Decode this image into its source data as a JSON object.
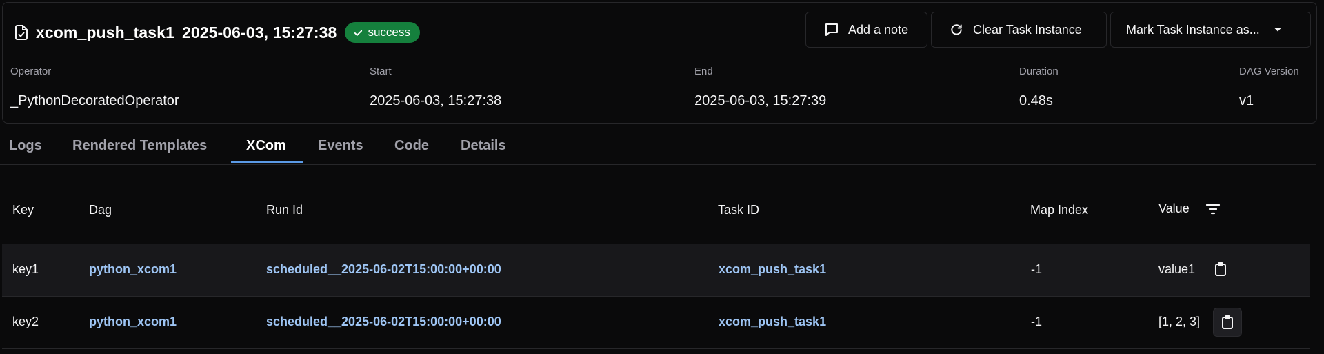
{
  "task": {
    "name": "xcom_push_task1",
    "datetime": "2025-06-03, 15:27:38",
    "status": "success"
  },
  "buttons": {
    "add_note": "Add a note",
    "clear": "Clear Task Instance",
    "mark": "Mark Task Instance as..."
  },
  "meta": {
    "operator": {
      "label": "Operator",
      "value": "_PythonDecoratedOperator"
    },
    "start": {
      "label": "Start",
      "value": "2025-06-03, 15:27:38"
    },
    "end": {
      "label": "End",
      "value": "2025-06-03, 15:27:39"
    },
    "duration": {
      "label": "Duration",
      "value": "0.48s"
    },
    "dag_version": {
      "label": "DAG Version",
      "value": "v1"
    }
  },
  "tabs": [
    "Logs",
    "Rendered Templates",
    "XCom",
    "Events",
    "Code",
    "Details"
  ],
  "active_tab": "XCom",
  "table": {
    "headers": {
      "key": "Key",
      "dag": "Dag",
      "run_id": "Run Id",
      "task_id": "Task ID",
      "map_index": "Map Index",
      "value": "Value"
    },
    "rows": [
      {
        "key": "key1",
        "dag": "python_xcom1",
        "run_id": "scheduled__2025-06-02T15:00:00+00:00",
        "task_id": "xcom_push_task1",
        "map_index": "-1",
        "value": "value1"
      },
      {
        "key": "key2",
        "dag": "python_xcom1",
        "run_id": "scheduled__2025-06-02T15:00:00+00:00",
        "task_id": "xcom_push_task1",
        "map_index": "-1",
        "value": "[1, 2, 3]"
      }
    ]
  },
  "icons": {
    "title": "file-check-icon",
    "badge": "check-icon",
    "note": "message-square-icon",
    "clear": "rotate-cw-icon",
    "mark": "chevron-down-icon",
    "filter": "filter-lines-icon",
    "copy": "clipboard-icon"
  },
  "colors": {
    "background": "#0a0a0b",
    "success": "#15803d",
    "link": "#9ec5f4",
    "tab_underline": "#5b9ae6"
  }
}
